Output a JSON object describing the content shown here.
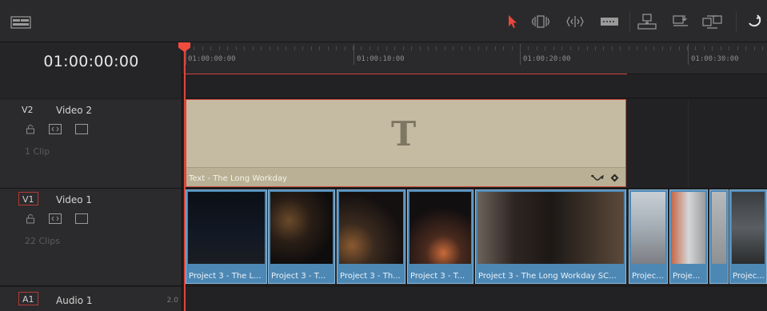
{
  "toolbar": {
    "icons": [
      "timeline-view-icon",
      "selection-pointer-icon",
      "trim-edit-icon",
      "dynamic-trim-icon",
      "blade-icon",
      "insert-clip-icon",
      "overwrite-clip-icon",
      "replace-clip-icon",
      "undo-icon"
    ],
    "accent_color": "#e8473c"
  },
  "timecode": "01:00:00:00",
  "ruler": {
    "labels": [
      "01:00:00:00",
      "01:00:10:00",
      "01:00:20:00",
      "01:00:30:00"
    ]
  },
  "tracks": {
    "v2": {
      "badge": "V2",
      "name": "Video 2",
      "clips": "1 Clip"
    },
    "v1": {
      "badge": "V1",
      "name": "Video 1",
      "clips": "22 Clips"
    },
    "a1": {
      "badge": "A1",
      "name": "Audio 1",
      "channels": "2.0"
    }
  },
  "title_clip": {
    "name": "Text - The Long Workday",
    "glyph": "T"
  },
  "video_clips": [
    "Project 3 - The L...",
    "Project 3 - T...",
    "Project 3 - Th...",
    "Project 3 - T...",
    "Project 3 - The Long Workday SC...",
    "Projec...",
    "Proje...",
    "",
    "Projec..."
  ],
  "colors": {
    "clip_blue": "#4d88b5",
    "title_clip": "#c5bba2",
    "playhead": "#e0453b"
  }
}
